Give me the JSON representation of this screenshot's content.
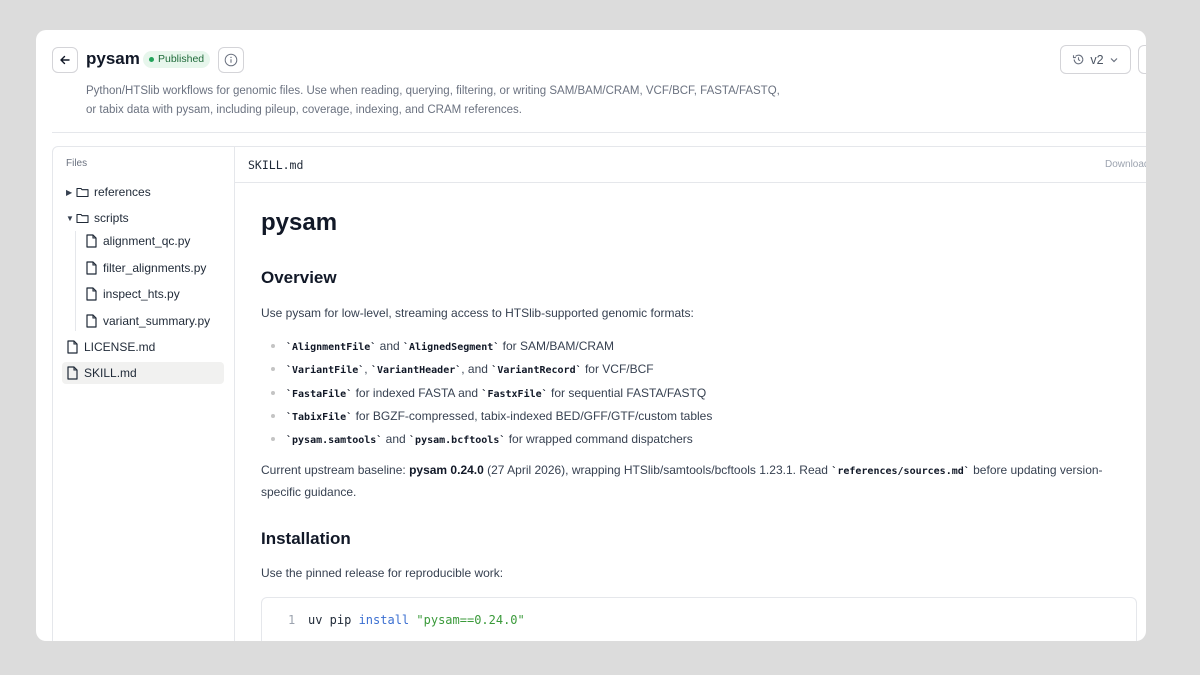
{
  "header": {
    "title": "pysam",
    "badge": "Published",
    "version": "v2",
    "description": "Python/HTSlib workflows for genomic files. Use when reading, querying, filtering, or writing SAM/BAM/CRAM, VCF/BCF, FASTA/FASTQ, or tabix data with pysam, including pileup, coverage, indexing, and CRAM references."
  },
  "sidebar": {
    "label": "Files",
    "items": [
      {
        "name": "references",
        "type": "folder",
        "expanded": false
      },
      {
        "name": "scripts",
        "type": "folder",
        "expanded": true
      },
      {
        "name": "alignment_qc.py",
        "type": "file"
      },
      {
        "name": "filter_alignments.py",
        "type": "file"
      },
      {
        "name": "inspect_hts.py",
        "type": "file"
      },
      {
        "name": "variant_summary.py",
        "type": "file"
      },
      {
        "name": "LICENSE.md",
        "type": "file"
      },
      {
        "name": "SKILL.md",
        "type": "file",
        "selected": true
      }
    ]
  },
  "editor": {
    "file_name": "SKILL.md",
    "download_label": "Download"
  },
  "doc": {
    "h1": "pysam",
    "overview_heading": "Overview",
    "overview_intro": "Use pysam for low-level, streaming access to HTSlib-supported genomic formats:",
    "bullets": [
      {
        "codes": [
          "`AlignmentFile`",
          "`AlignedSegment`"
        ],
        "seps": [
          " and "
        ],
        "tail": " for SAM/BAM/CRAM"
      },
      {
        "codes": [
          "`VariantFile`",
          "`VariantHeader`",
          "`VariantRecord`"
        ],
        "seps": [
          ", ",
          ", and "
        ],
        "tail": " for VCF/BCF"
      },
      {
        "codes": [
          "`FastaFile`",
          "`FastxFile`"
        ],
        "seps": [
          " for indexed FASTA and "
        ],
        "tail": " for sequential FASTA/FASTQ"
      },
      {
        "codes": [
          "`TabixFile`"
        ],
        "seps": [],
        "tail": " for BGZF-compressed, tabix-indexed BED/GFF/GTF/custom tables"
      },
      {
        "codes": [
          "`pysam.samtools`",
          "`pysam.bcftools`"
        ],
        "seps": [
          " and "
        ],
        "tail": " for wrapped command dispatchers"
      }
    ],
    "baseline_prefix": "Current upstream baseline: ",
    "baseline_version": "pysam 0.24.0",
    "baseline_mid": " (27 April 2026), wrapping HTSlib/samtools/bcftools 1.23.1. Read ",
    "baseline_code": "`references/sources.md`",
    "baseline_suffix": " before updating version-specific guidance.",
    "install_heading": "Installation",
    "install_intro": "Use the pinned release for reproducible work:",
    "code": {
      "line_number": "1",
      "cmd": "uv pip ",
      "kw": "install",
      "str": "\"pysam==0.24.0\""
    }
  }
}
